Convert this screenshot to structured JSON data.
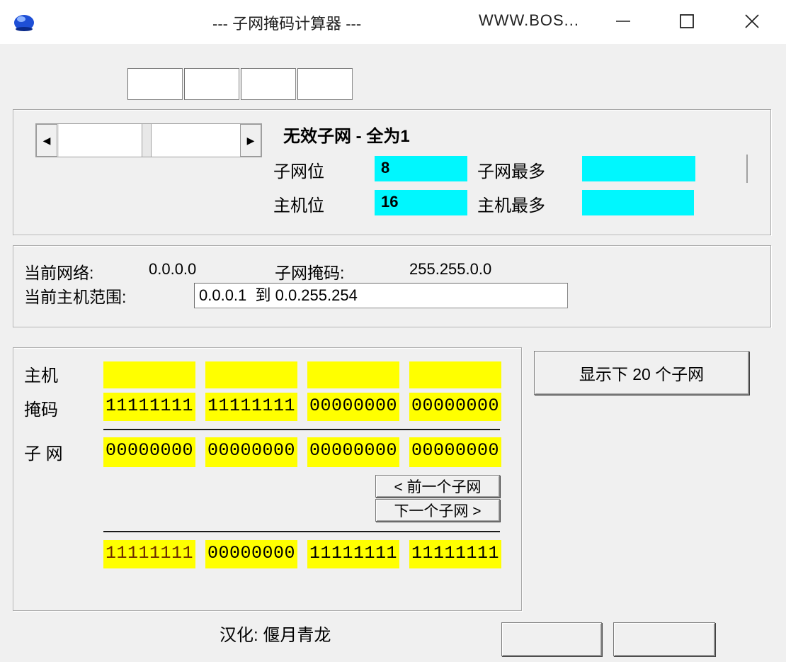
{
  "window": {
    "title": "--- 子网掩码计算器 ---",
    "title_url": "WWW.BOS..."
  },
  "status": {
    "title": "无效子网 - 全为1",
    "subnet_bits_label": "子网位",
    "subnet_bits_value": "8",
    "subnet_max_label": "子网最多",
    "subnet_max_value": "",
    "host_bits_label": "主机位",
    "host_bits_value": "16",
    "host_max_label": "主机最多",
    "host_max_value": ""
  },
  "network": {
    "current_network_label": "当前网络:",
    "current_network_value": "0.0.0.0",
    "subnet_mask_label": "子网掩码:",
    "subnet_mask_value": "255.255.0.0",
    "host_range_label": "当前主机范围:",
    "host_range_value": "0.0.0.1  到 0.0.255.254"
  },
  "binary": {
    "host_label": "主机",
    "mask_label": "掩码",
    "subnet_label": "子 网",
    "host_octets": [
      "",
      "",
      "",
      ""
    ],
    "mask_octets": [
      "11111111",
      "11111111",
      "00000000",
      "00000000"
    ],
    "subnet_octets": [
      "00000000",
      "00000000",
      "00000000",
      "00000000"
    ],
    "last_octets": [
      "11111111",
      "00000000",
      "11111111",
      "11111111"
    ]
  },
  "buttons": {
    "prev_subnet": "< 前一个子网",
    "next_subnet": "下一个子网 >",
    "show_next_20": "显示下 20 个子网"
  },
  "footer": {
    "credit": "汉化: 偃月青龙"
  },
  "colors": {
    "cyan": "#00f7fe",
    "yellow": "#ffff00"
  }
}
